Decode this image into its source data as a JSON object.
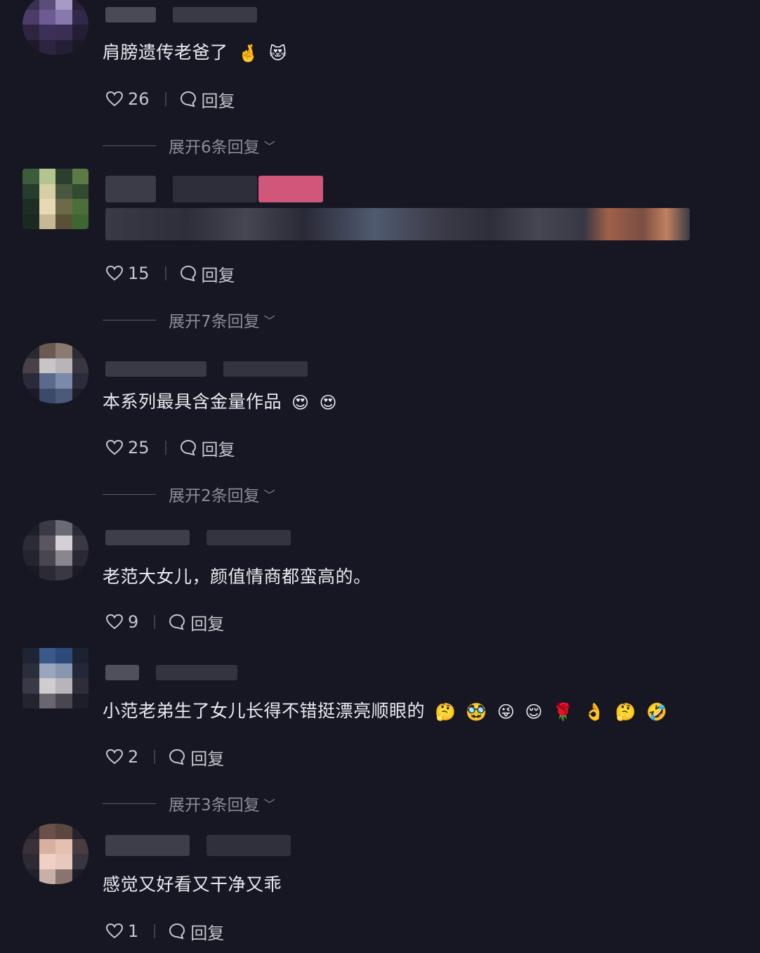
{
  "comments": [
    {
      "text": "肩膀遗传老爸了",
      "emojis": [
        "🤞",
        "😻"
      ],
      "likes": "26",
      "reply_label": "回复",
      "expand_label": "展开6条回复"
    },
    {
      "text": "",
      "emojis": [],
      "likes": "15",
      "reply_label": "回复",
      "expand_label": "展开7条回复"
    },
    {
      "text": "本系列最具含金量作品",
      "emojis": [
        "😍",
        "😍"
      ],
      "likes": "25",
      "reply_label": "回复",
      "expand_label": "展开2条回复"
    },
    {
      "text": "老范大女儿，颜值情商都蛮高的。",
      "emojis": [],
      "likes": "9",
      "reply_label": "回复",
      "expand_label": ""
    },
    {
      "text": "小范老弟生了女儿长得不错挺漂亮顺眼的",
      "emojis": [
        "🤔",
        "🥸",
        "😜",
        "😌",
        "🌹",
        "👌",
        "🤔",
        "🤣"
      ],
      "likes": "2",
      "reply_label": "回复",
      "expand_label": "展开3条回复"
    },
    {
      "text": "感觉又好看又干净又乖",
      "emojis": [],
      "likes": "1",
      "reply_label": "回复",
      "expand_label": ""
    }
  ],
  "colors": {
    "background": "#161722",
    "text": "#eceaf0",
    "muted": "#8b8c96"
  }
}
